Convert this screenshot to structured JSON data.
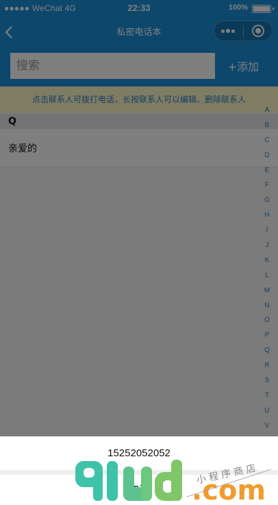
{
  "status": {
    "carrier": "●●●●● WeChat 4G",
    "time": "22:33",
    "battery": "100%"
  },
  "nav": {
    "title": "私密电话本",
    "icons": [
      "back-icon",
      "more-icon",
      "close-target-icon"
    ]
  },
  "search": {
    "placeholder": "搜索",
    "add_label": "+添加"
  },
  "tip": "点击联系人可拨打电话，长按联系人可以编辑、删除联系人",
  "contacts": {
    "group": "Q",
    "items": [
      "亲爱的"
    ]
  },
  "alphabet": [
    "A",
    "B",
    "C",
    "D",
    "E",
    "F",
    "G",
    "H",
    "I",
    "J",
    "K",
    "L",
    "M",
    "N",
    "O",
    "P",
    "Q",
    "R",
    "S",
    "T",
    "U",
    "V"
  ],
  "action_sheet": {
    "phone": "15252052052",
    "cancel": "取消"
  },
  "watermark": {
    "logo": "91ud",
    "domain": ".com",
    "tagline": "小程序商店"
  },
  "colors": {
    "primary": "#1a8fd8",
    "tip_bg": "#fff8c8",
    "tip_text": "#2d7fc6",
    "logo_teal": "#3ec2a8",
    "logo_orange": "#f39a2c"
  }
}
